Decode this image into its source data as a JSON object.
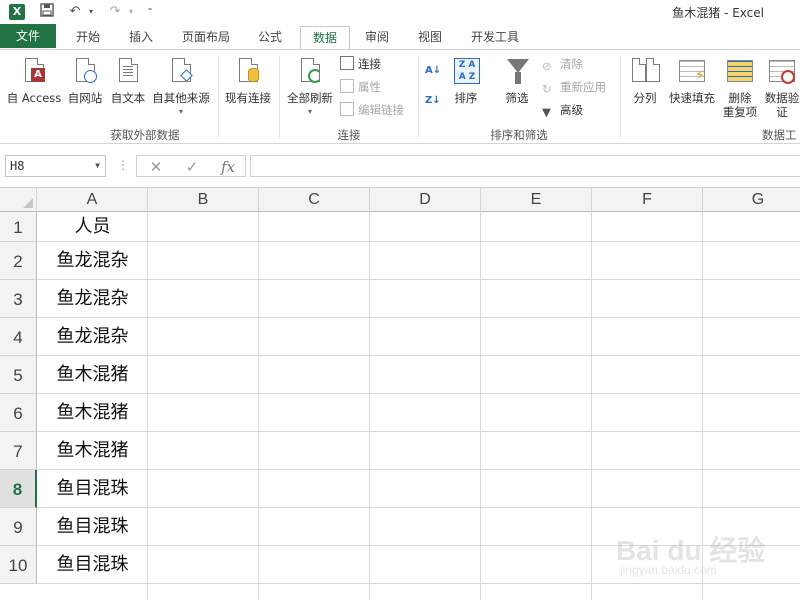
{
  "app": {
    "logo": "X",
    "window_title": "鱼木混猪 - Excel",
    "quick_access": [
      "save-icon",
      "undo-icon",
      "redo-icon",
      "customize-icon"
    ]
  },
  "tabs": [
    {
      "label": "文件"
    },
    {
      "label": "开始"
    },
    {
      "label": "插入"
    },
    {
      "label": "页面布局"
    },
    {
      "label": "公式"
    },
    {
      "label": "数据",
      "active": true
    },
    {
      "label": "审阅"
    },
    {
      "label": "视图"
    },
    {
      "label": "开发工具"
    }
  ],
  "ribbon": {
    "group_external": {
      "label": "获取外部数据",
      "from_access": "自 Access",
      "from_web": "自网站",
      "from_text": "自文本",
      "from_other": "自其他来源",
      "existing": "现有连接"
    },
    "group_connections": {
      "label": "连接",
      "refresh_all": "全部刷新",
      "connections": "连接",
      "properties": "属性",
      "edit_links": "编辑链接"
    },
    "group_sort_filter": {
      "label": "排序和筛选",
      "sort": "排序",
      "filter": "筛选",
      "clear": "清除",
      "reapply": "重新应用",
      "advanced": "高级"
    },
    "group_data_tools": {
      "label": "数据工",
      "text_to_columns": "分列",
      "flash_fill": "快速填充",
      "remove_dup_1": "删除",
      "remove_dup_2": "重复项",
      "validation_1": "数据验",
      "validation_2": "证"
    }
  },
  "formula_bar": {
    "name_box": "H8",
    "cancel_icon": "✕",
    "enter_icon": "✓",
    "fx_label": "fx",
    "formula": ""
  },
  "sheet": {
    "columns": [
      "A",
      "B",
      "C",
      "D",
      "E",
      "F",
      "G"
    ],
    "rows": [
      "1",
      "2",
      "3",
      "4",
      "5",
      "6",
      "7",
      "8",
      "9",
      "10"
    ],
    "selected_row": "8",
    "column_a": [
      "人员",
      "鱼龙混杂",
      "鱼龙混杂",
      "鱼龙混杂",
      "鱼木混猪",
      "鱼木混猪",
      "鱼木混猪",
      "鱼目混珠",
      "鱼目混珠",
      "鱼目混珠"
    ]
  },
  "watermark": {
    "main": "Bai du 经验",
    "sub": "jingyan.baidu.com"
  },
  "colors": {
    "excel_green": "#217346",
    "header_bg": "#f3f3f3"
  }
}
